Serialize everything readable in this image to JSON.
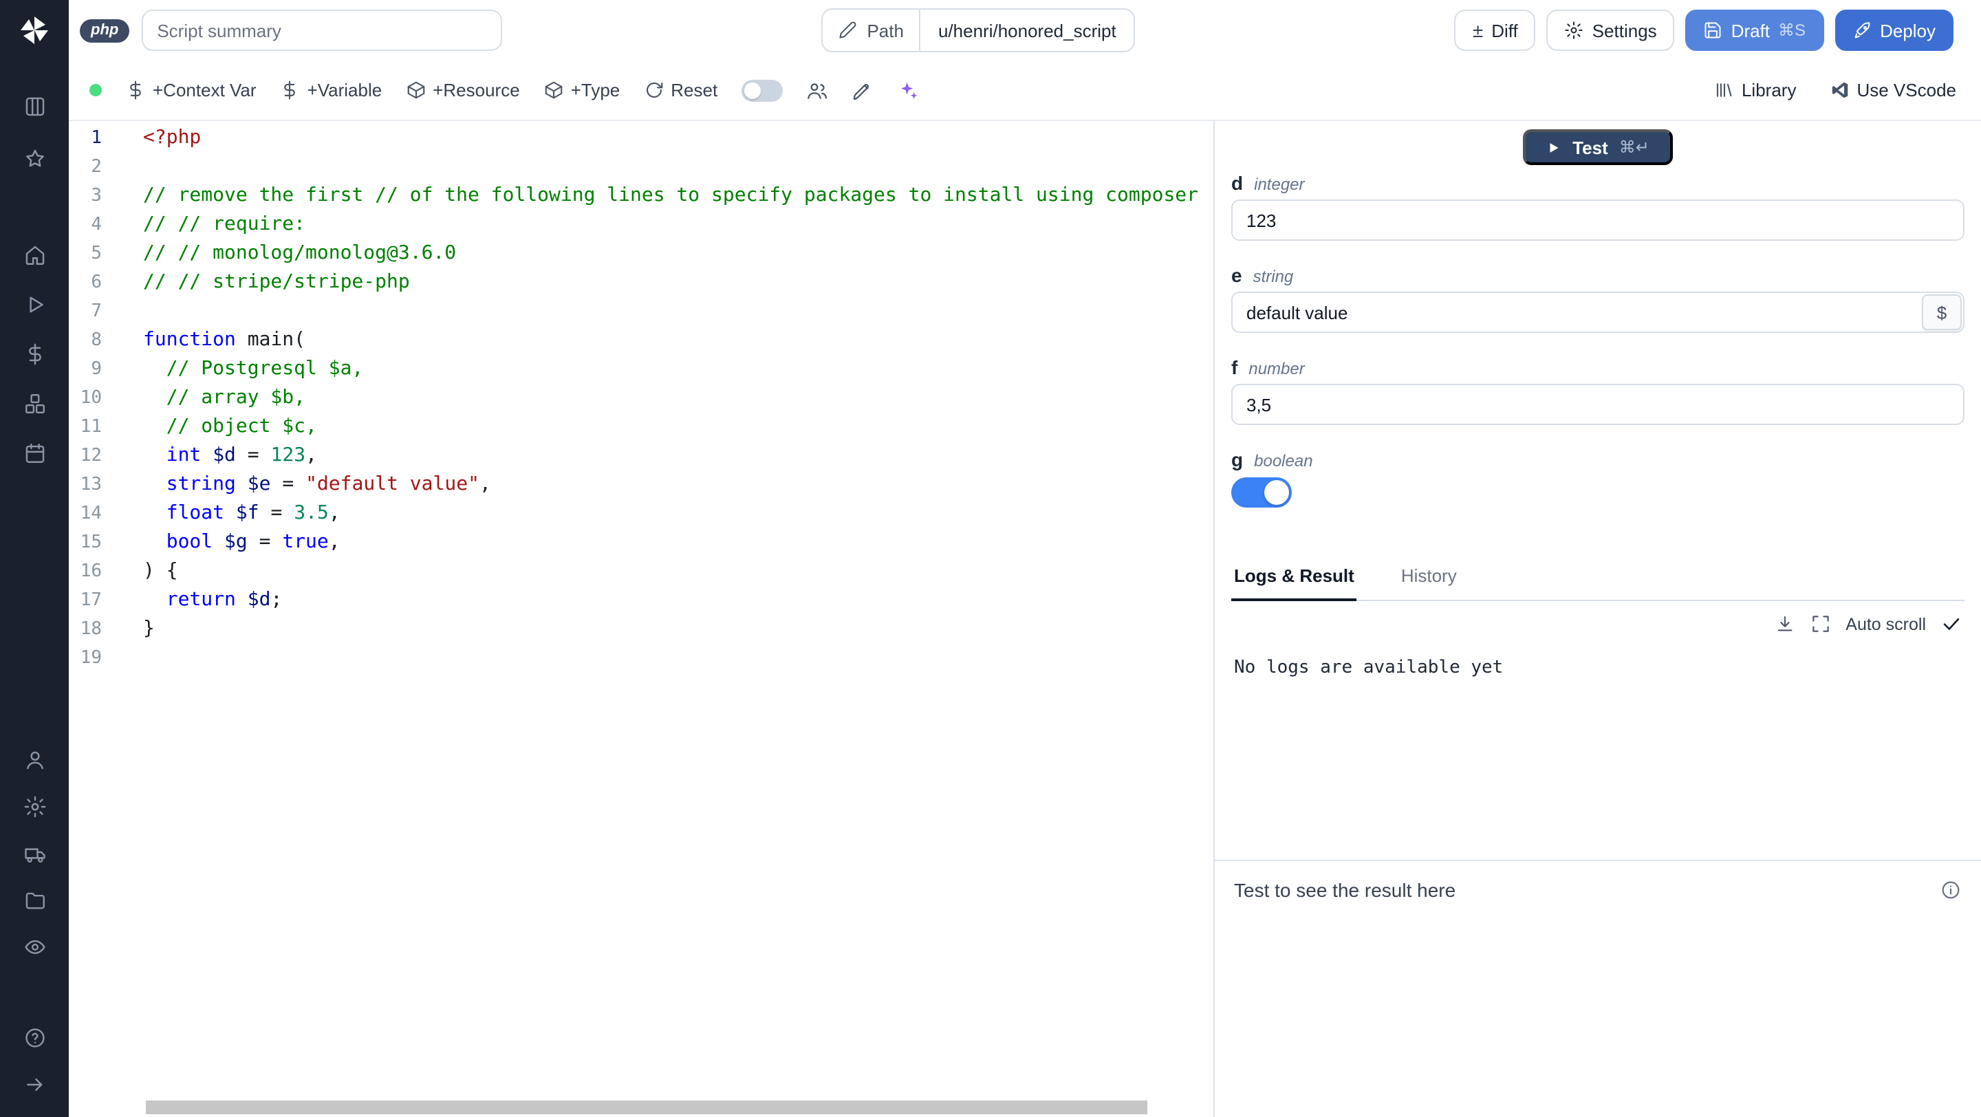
{
  "topbar": {
    "language": "php",
    "summary_placeholder": "Script summary",
    "path_label": "Path",
    "path_value": "u/henri/honored_script",
    "diff": "Diff",
    "settings": "Settings",
    "draft": "Draft",
    "draft_shortcut": "⌘S",
    "deploy": "Deploy"
  },
  "toolbar": {
    "add_context_var": "+Context Var",
    "add_variable": "+Variable",
    "add_resource": "+Resource",
    "add_type": "+Type",
    "reset": "Reset",
    "library": "Library",
    "use_vscode": "Use VScode"
  },
  "editor": {
    "active_line": 1,
    "lines": [
      {
        "n": 1,
        "segs": [
          [
            "tag",
            "<?php"
          ]
        ]
      },
      {
        "n": 2,
        "segs": []
      },
      {
        "n": 3,
        "segs": [
          [
            "comment",
            "// remove the first // of the following lines to specify packages to install using composer"
          ]
        ]
      },
      {
        "n": 4,
        "segs": [
          [
            "comment",
            "// // require:"
          ]
        ]
      },
      {
        "n": 5,
        "segs": [
          [
            "comment",
            "// // monolog/monolog@3.6.0"
          ]
        ]
      },
      {
        "n": 6,
        "segs": [
          [
            "comment",
            "// // stripe/stripe-php"
          ]
        ]
      },
      {
        "n": 7,
        "segs": []
      },
      {
        "n": 8,
        "segs": [
          [
            "keyword",
            "function"
          ],
          [
            "plain",
            " main("
          ]
        ]
      },
      {
        "n": 9,
        "segs": [
          [
            "comment",
            "  // Postgresql $a,"
          ]
        ]
      },
      {
        "n": 10,
        "segs": [
          [
            "comment",
            "  // array $b,"
          ]
        ]
      },
      {
        "n": 11,
        "segs": [
          [
            "comment",
            "  // object $c,"
          ]
        ]
      },
      {
        "n": 12,
        "segs": [
          [
            "plain",
            "  "
          ],
          [
            "keyword",
            "int"
          ],
          [
            "plain",
            " "
          ],
          [
            "variable",
            "$d"
          ],
          [
            "plain",
            " = "
          ],
          [
            "number",
            "123"
          ],
          [
            "plain",
            ","
          ]
        ]
      },
      {
        "n": 13,
        "segs": [
          [
            "plain",
            "  "
          ],
          [
            "keyword",
            "string"
          ],
          [
            "plain",
            " "
          ],
          [
            "variable",
            "$e"
          ],
          [
            "plain",
            " = "
          ],
          [
            "string",
            "\"default value\""
          ],
          [
            "plain",
            ","
          ]
        ]
      },
      {
        "n": 14,
        "segs": [
          [
            "plain",
            "  "
          ],
          [
            "keyword",
            "float"
          ],
          [
            "plain",
            " "
          ],
          [
            "variable",
            "$f"
          ],
          [
            "plain",
            " = "
          ],
          [
            "number",
            "3.5"
          ],
          [
            "plain",
            ","
          ]
        ]
      },
      {
        "n": 15,
        "segs": [
          [
            "plain",
            "  "
          ],
          [
            "keyword",
            "bool"
          ],
          [
            "plain",
            " "
          ],
          [
            "variable",
            "$g"
          ],
          [
            "plain",
            " = "
          ],
          [
            "keyword",
            "true"
          ],
          [
            "plain",
            ","
          ]
        ]
      },
      {
        "n": 16,
        "segs": [
          [
            "plain",
            ") {"
          ]
        ]
      },
      {
        "n": 17,
        "segs": [
          [
            "plain",
            "  "
          ],
          [
            "keyword",
            "return"
          ],
          [
            "plain",
            " "
          ],
          [
            "variable",
            "$d"
          ],
          [
            "plain",
            ";"
          ]
        ]
      },
      {
        "n": 18,
        "segs": [
          [
            "plain",
            "}"
          ]
        ]
      },
      {
        "n": 19,
        "segs": []
      }
    ]
  },
  "right_panel": {
    "test": "Test",
    "test_shortcut": "⌘↵",
    "dollar_label": "$",
    "fields": [
      {
        "name": "d",
        "type": "integer",
        "control": "text",
        "value": "123"
      },
      {
        "name": "e",
        "type": "string",
        "control": "text-dollar",
        "value": "default value"
      },
      {
        "name": "f",
        "type": "number",
        "control": "text",
        "value": "3,5"
      },
      {
        "name": "g",
        "type": "boolean",
        "control": "toggle",
        "value": true
      }
    ],
    "tabs": [
      "Logs & Result",
      "History"
    ],
    "active_tab": 0,
    "auto_scroll_label": "Auto scroll",
    "no_logs_text": "No logs are available yet",
    "result_placeholder": "Test to see the result here"
  },
  "colors": {
    "sidebar_bg": "#1b212c",
    "accent_blue": "#3b82f6",
    "draft_button": "#5584dc",
    "deploy_button": "#3d6fd2",
    "test_button": "#2f4668",
    "status_green": "#4ade80",
    "ai_violet": "#8b5cf6",
    "tokens": {
      "tag": "#a31515",
      "comment": "#008000",
      "keyword": "#0000ff",
      "number": "#098658",
      "string": "#a31515",
      "variable": "#001080",
      "plain": "#1b1f24"
    }
  }
}
